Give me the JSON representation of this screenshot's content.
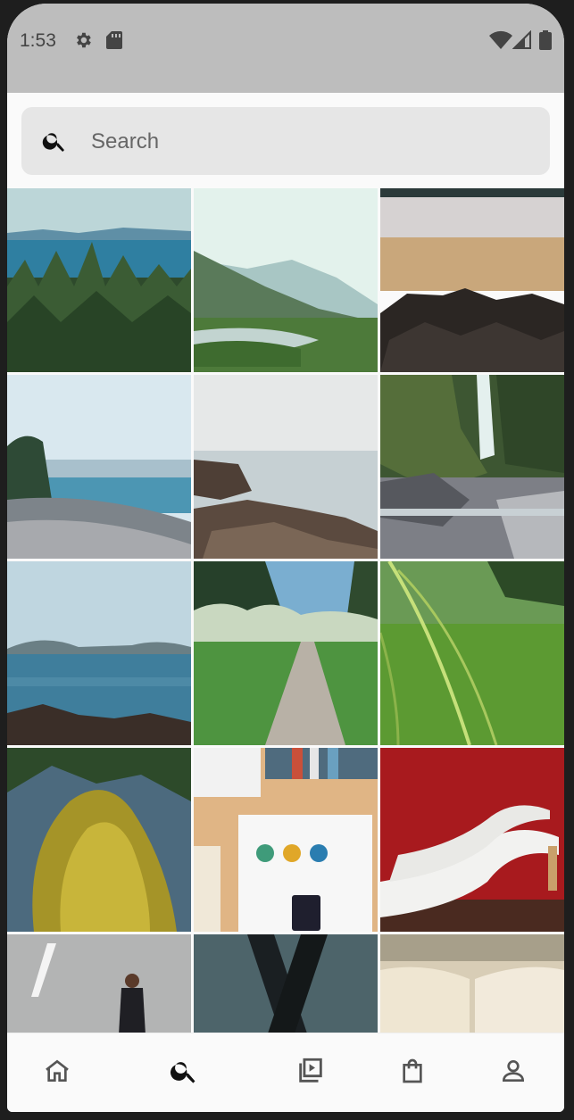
{
  "status_bar": {
    "time": "1:53",
    "icons": [
      "gear-icon",
      "sd-card-icon",
      "wifi-icon",
      "signal-icon",
      "battery-icon"
    ]
  },
  "search": {
    "placeholder": "Search",
    "value": ""
  },
  "photos": [
    {
      "subject": "forest-lake"
    },
    {
      "subject": "misty-valley-river"
    },
    {
      "subject": "beach-rocks"
    },
    {
      "subject": "pebble-beach"
    },
    {
      "subject": "sea-rocks"
    },
    {
      "subject": "waterfall"
    },
    {
      "subject": "bay-coastline"
    },
    {
      "subject": "park-path"
    },
    {
      "subject": "grass-closeup"
    },
    {
      "subject": "mossy-tree"
    },
    {
      "subject": "desk-books-phone"
    },
    {
      "subject": "white-heels"
    },
    {
      "subject": "man-on-street"
    },
    {
      "subject": "blurred-fork"
    },
    {
      "subject": "open-book"
    }
  ],
  "bottom_nav": [
    {
      "icon": "home-icon",
      "active": false
    },
    {
      "icon": "search-icon",
      "active": true
    },
    {
      "icon": "video-library-icon",
      "active": false
    },
    {
      "icon": "shopping-bag-icon",
      "active": false
    },
    {
      "icon": "profile-icon",
      "active": false
    }
  ],
  "colors": {
    "status_bar": "#bdbdbd",
    "background": "#fafafa",
    "search_box": "#e6e6e6",
    "active_icon": "#111111",
    "inactive_icon": "#555555"
  }
}
